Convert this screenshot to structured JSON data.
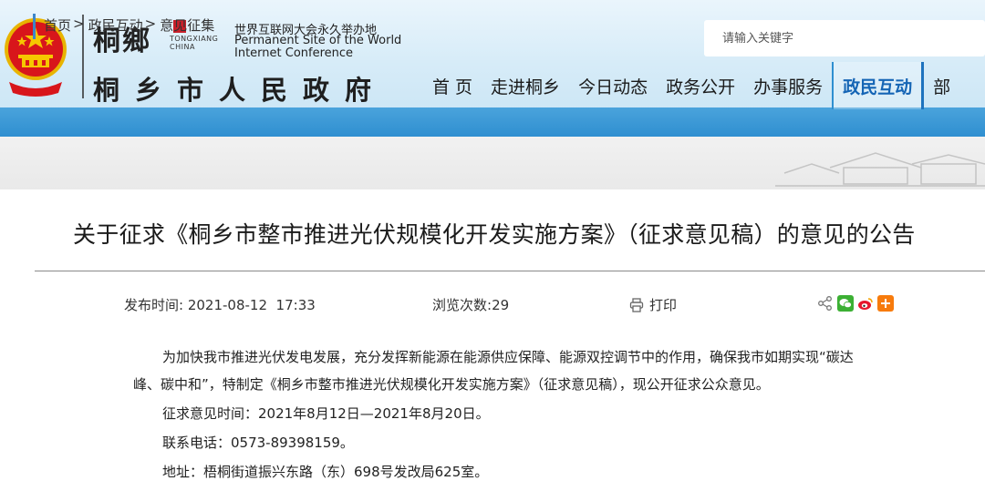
{
  "header": {
    "logo_calligraphy": "桐鄉",
    "logo_pinyin_line1": "TONGXIANG",
    "logo_pinyin_line2": "CHINA",
    "wic_cn": "世界互联网大会永久举办地",
    "wic_en_line1": "Permanent Site of the World",
    "wic_en_line2": "Internet Conference",
    "site_title": "桐乡市人民政府"
  },
  "search": {
    "placeholder": "请输入关键字"
  },
  "nav": {
    "items": [
      {
        "label": "首 页"
      },
      {
        "label": "走进桐乡"
      },
      {
        "label": "今日动态"
      },
      {
        "label": "政务公开"
      },
      {
        "label": "办事服务"
      },
      {
        "label": "政民互动"
      },
      {
        "label": "部"
      }
    ],
    "active_index": 5
  },
  "breadcrumb": {
    "items": [
      "首页",
      "政民互动",
      "意见征集"
    ],
    "separator": ">"
  },
  "article": {
    "title": "关于征求《桐乡市整市推进光伏规模化开发实施方案》（征求意见稿）的意见的公告",
    "publish_label": "发布时间:",
    "publish_time": "2021-08-12  17:33",
    "views_label": "浏览次数:",
    "views": "29",
    "print_label": "打印",
    "paragraphs": [
      "为加快我市推进光伏发电发展，充分发挥新能源在能源供应保障、能源双控调节中的作用，确保我市如期实现“碳达",
      "峰、碳中和”，特制定《桐乡市整市推进光伏规模化开发实施方案》（征求意见稿），现公开征求公众意见。",
      "征求意见时间：2021年8月12日—2021年8月20日。",
      "联系电话：0573-89398159。",
      "地址：梧桐街道振兴东路（东）698号发改局625室。"
    ]
  },
  "share_icons": [
    "share-icon",
    "wechat-icon",
    "weibo-icon",
    "plus-share-icon"
  ],
  "colors": {
    "nav_active": "#1565b5",
    "header_band": "#2f8fd0",
    "emblem_red": "#d8161b",
    "emblem_gold": "#f6c700"
  }
}
